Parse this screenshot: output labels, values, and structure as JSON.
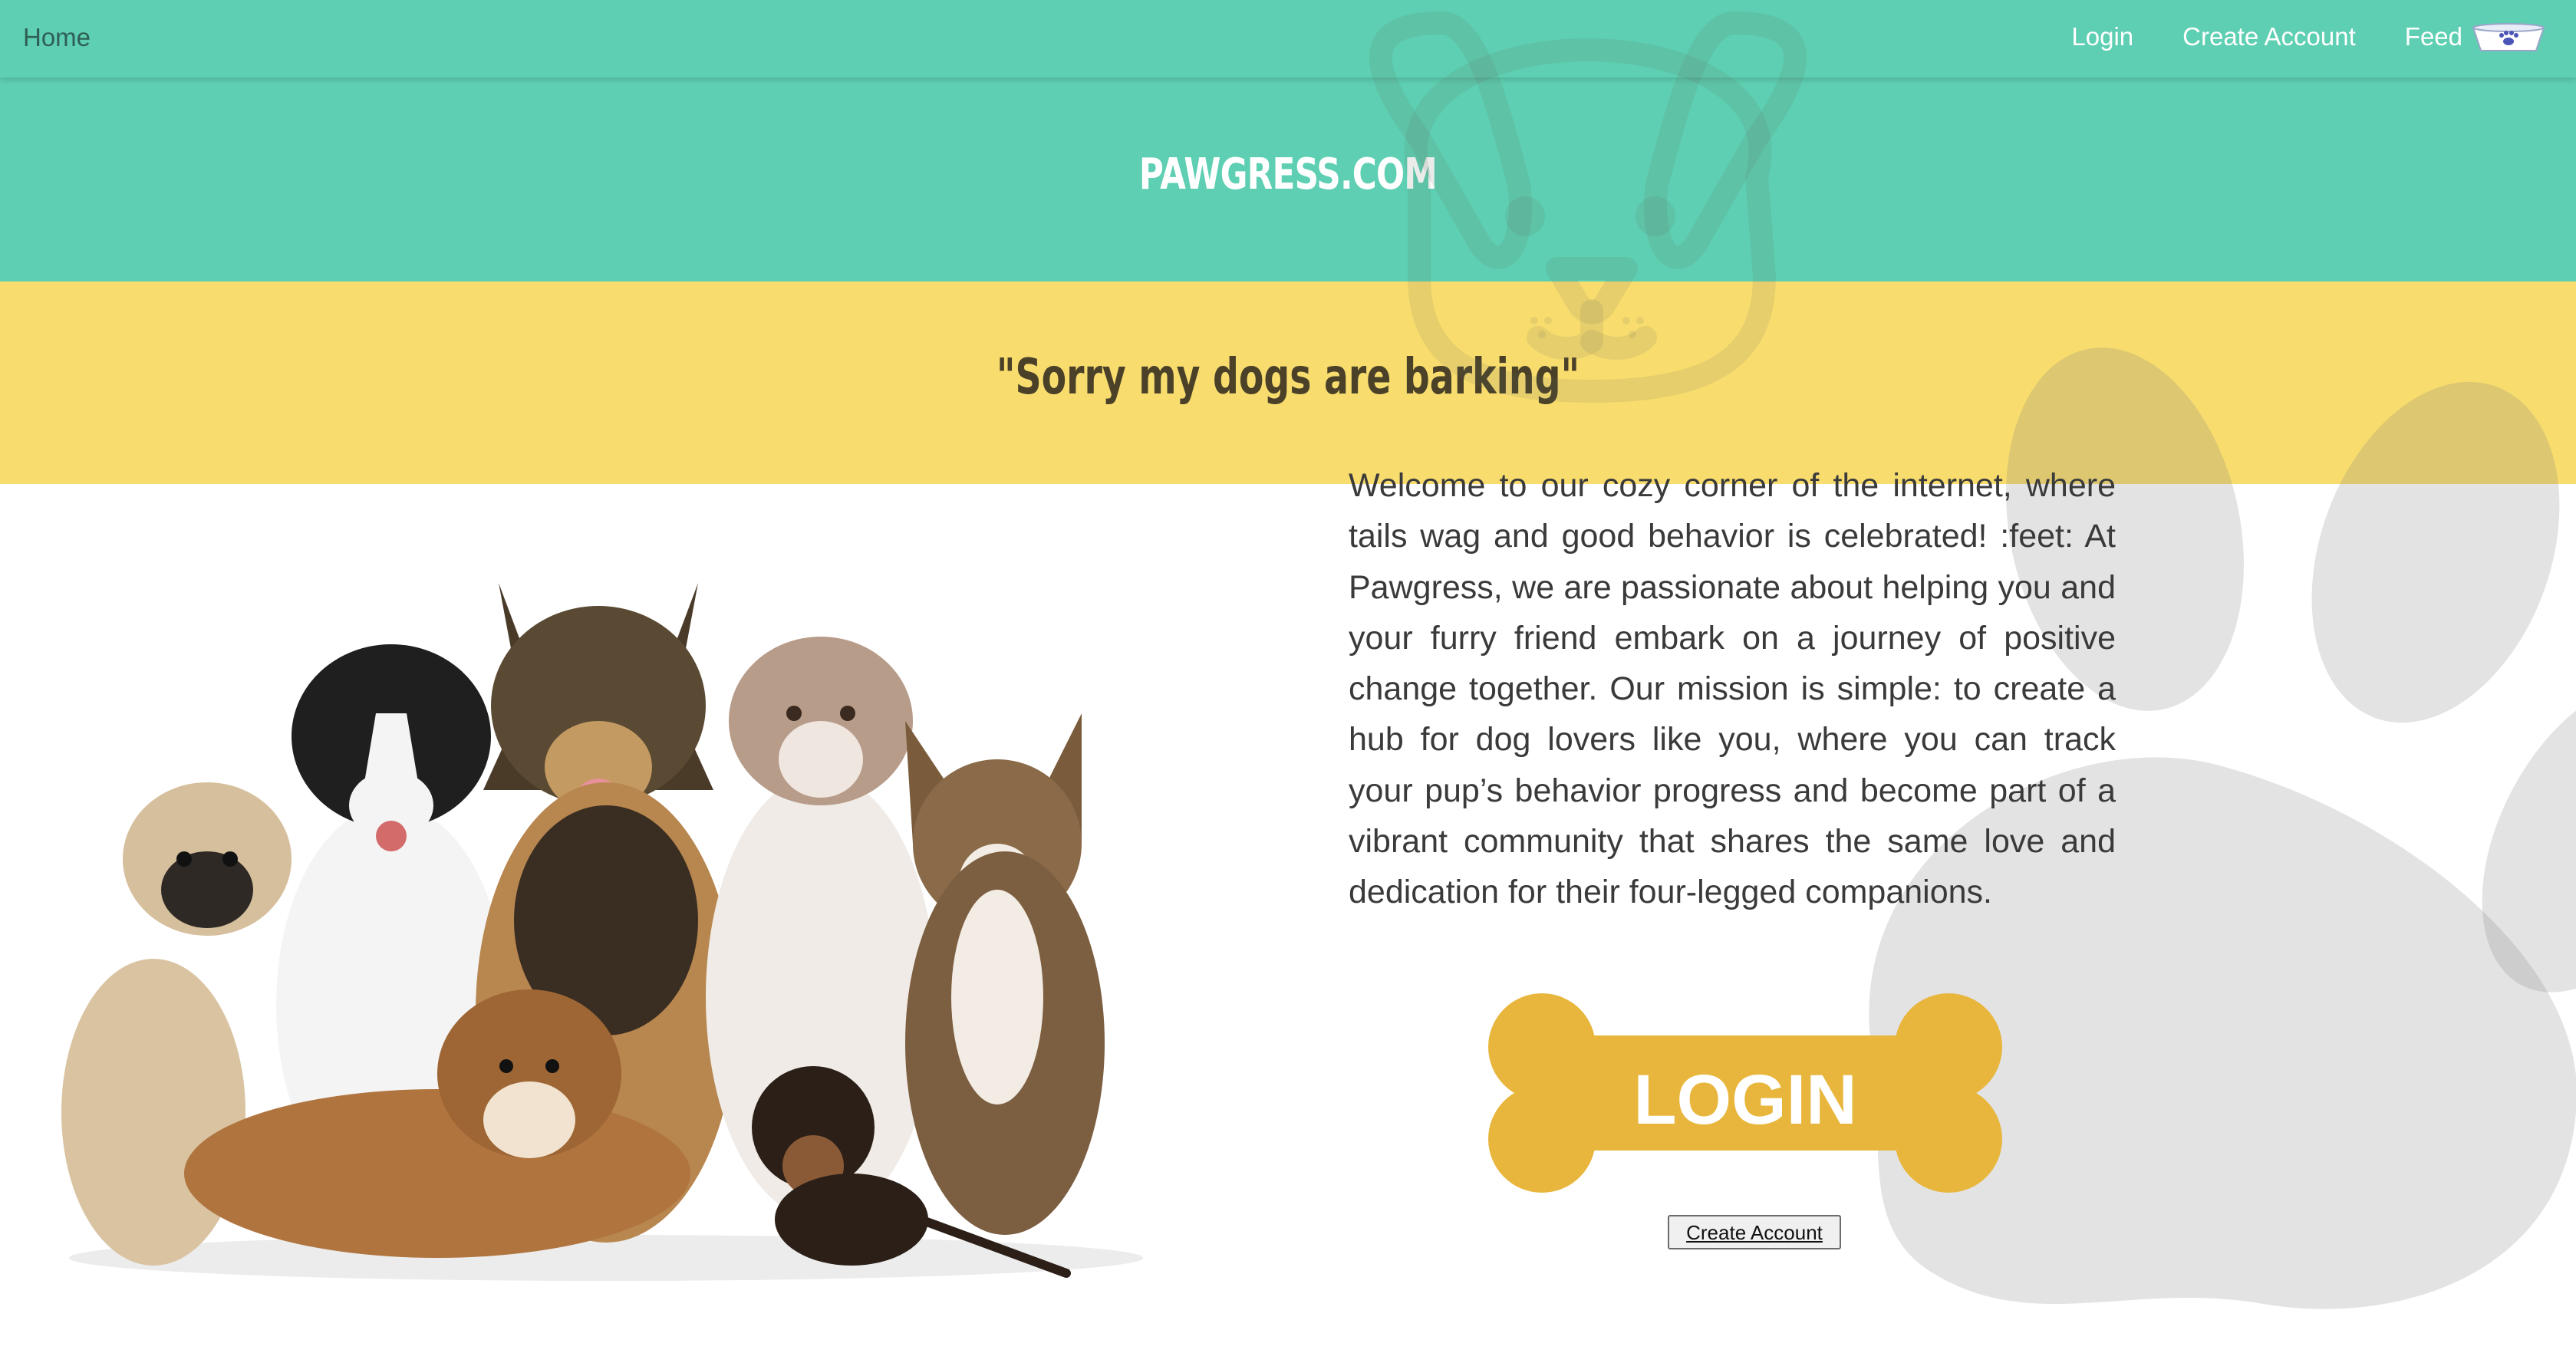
{
  "nav": {
    "home": "Home",
    "login": "Login",
    "create_account": "Create Account",
    "feed": "Feed"
  },
  "hero": {
    "title": "PAWGRESS.COM",
    "quote": "\"Sorry my dogs are barking\""
  },
  "main": {
    "welcome_text": "Welcome to our cozy corner of the internet, where tails wag and good behavior is celebrated! :feet: At Pawgress, we are passionate about helping you and your furry friend embark on a journey of positive change together. Our mission is simple: to create a hub for dog lovers like you, where you can track your pup’s behavior progress and become part of a vibrant community that shares the same love and dedication for their four-legged companions.",
    "login_bone_label": "LOGIN",
    "create_account_button": "Create Account"
  },
  "icons": {
    "feed": "dog-bowl-icon",
    "background": [
      "dog-face-icon",
      "paw-print-icon"
    ]
  },
  "colors": {
    "teal": "#5ecfb2",
    "yellow": "#f8dd6e",
    "bone": "#e8b63c",
    "text": "#3a3a3a"
  }
}
